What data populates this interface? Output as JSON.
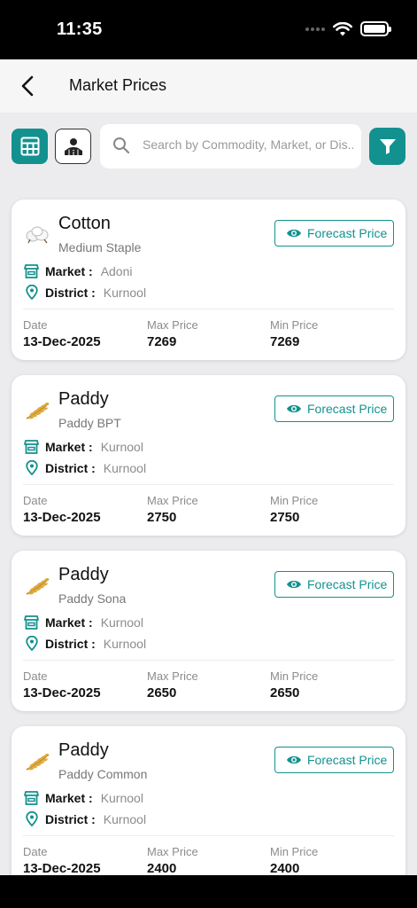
{
  "status_bar": {
    "time": "11:35"
  },
  "header": {
    "title": "Market Prices"
  },
  "search": {
    "placeholder": "Search by Commodity, Market, or Dis..."
  },
  "labels": {
    "forecast": "Forecast Price",
    "market": "Market :",
    "district": "District :",
    "date": "Date",
    "max_price": "Max Price",
    "min_price": "Min Price"
  },
  "colors": {
    "accent": "#13918f"
  },
  "cards": [
    {
      "commodity": "Cotton",
      "variety": "Medium Staple",
      "icon": "cotton-icon",
      "market": "Adoni",
      "district": "Kurnool",
      "date": "13-Dec-2025",
      "max_price": "7269",
      "min_price": "7269"
    },
    {
      "commodity": "Paddy",
      "variety": "Paddy BPT",
      "icon": "paddy-icon",
      "market": "Kurnool",
      "district": "Kurnool",
      "date": "13-Dec-2025",
      "max_price": "2750",
      "min_price": "2750"
    },
    {
      "commodity": "Paddy",
      "variety": "Paddy Sona",
      "icon": "paddy-icon",
      "market": "Kurnool",
      "district": "Kurnool",
      "date": "13-Dec-2025",
      "max_price": "2650",
      "min_price": "2650"
    },
    {
      "commodity": "Paddy",
      "variety": "Paddy Common",
      "icon": "paddy-icon",
      "market": "Kurnool",
      "district": "Kurnool",
      "date": "13-Dec-2025",
      "max_price": "2400",
      "min_price": "2400"
    }
  ]
}
